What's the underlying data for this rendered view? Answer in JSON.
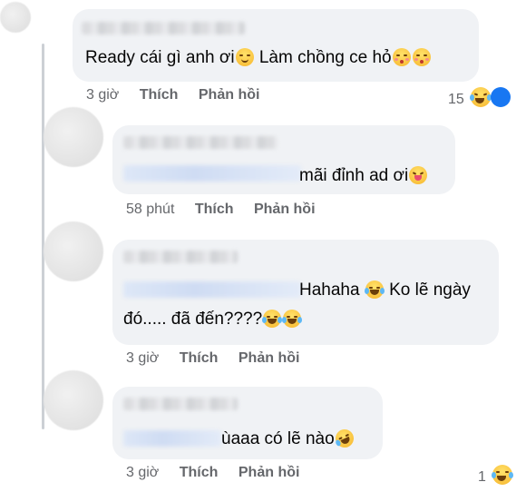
{
  "comments": [
    {
      "text_parts": [
        "Ready cái gì anh ơi",
        "relieved",
        " Làm chồng ce hỏ",
        "kiss",
        "kiss"
      ],
      "time": "3 giờ",
      "like": "Thích",
      "reply": "Phản hồi",
      "reaction_count": "15",
      "reaction_icon": "laugh-emoji-icon"
    },
    {
      "text_line1": "mãi đỉnh ad ơi",
      "line1_emoji": "tongue-emoji-icon",
      "time": "58 phút",
      "like": "Thích",
      "reply": "Phản hồi"
    },
    {
      "text_line1": "Hahaha",
      "text_line1b": " Ko lẽ ngày",
      "text_line2": "đó..... đã đến????",
      "time": "3 giờ",
      "like": "Thích",
      "reply": "Phản hồi"
    },
    {
      "text_line1": "ùaaa có lẽ nào",
      "line1_emoji": "rofl-emoji-icon",
      "time": "3 giờ",
      "like": "Thích",
      "reply": "Phản hồi",
      "reaction_count": "1",
      "reaction_icon": "laugh-emoji-icon"
    }
  ]
}
